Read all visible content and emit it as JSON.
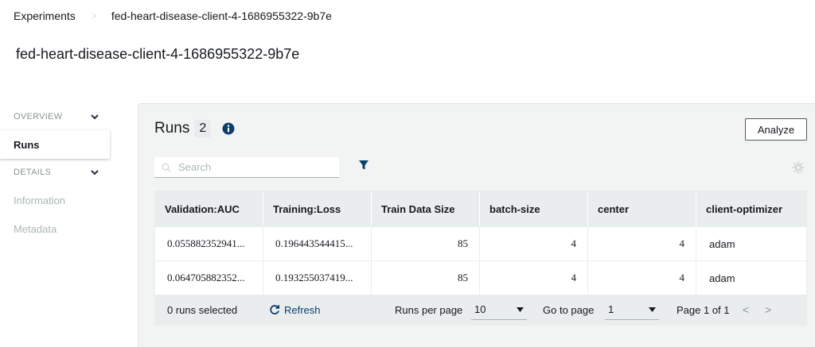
{
  "breadcrumb": {
    "root": "Experiments",
    "separator": ">",
    "current": "fed-heart-disease-client-4-1686955322-9b7e"
  },
  "page_title": "fed-heart-disease-client-4-1686955322-9b7e",
  "sidebar": {
    "overview_label": "OVERVIEW",
    "runs_label": "Runs",
    "details_label": "DETAILS",
    "information_label": "Information",
    "metadata_label": "Metadata"
  },
  "runs": {
    "title": "Runs",
    "count": "2",
    "analyze_label": "Analyze",
    "search_placeholder": "Search"
  },
  "table": {
    "columns": [
      "Validation:AUC",
      "Training:Loss",
      "Train Data Size",
      "batch-size",
      "center",
      "client-optimizer"
    ],
    "rows": [
      [
        "0.055882352941...",
        "0.196443544415...",
        "85",
        "4",
        "4",
        "adam"
      ],
      [
        "0.064705882352...",
        "0.193255037419...",
        "85",
        "4",
        "4",
        "adam"
      ]
    ]
  },
  "footer": {
    "selected_text": "0 runs selected",
    "refresh_label": "Refresh",
    "runs_per_page_label": "Runs per page",
    "runs_per_page_value": "10",
    "goto_label": "Go to page",
    "goto_value": "1",
    "page_text": "Page 1 of 1",
    "prev": "<",
    "next": ">"
  },
  "colors": {
    "accent": "#0a3e6e",
    "panel_bg": "#f2f3f3",
    "header_bg": "#eaeded"
  }
}
